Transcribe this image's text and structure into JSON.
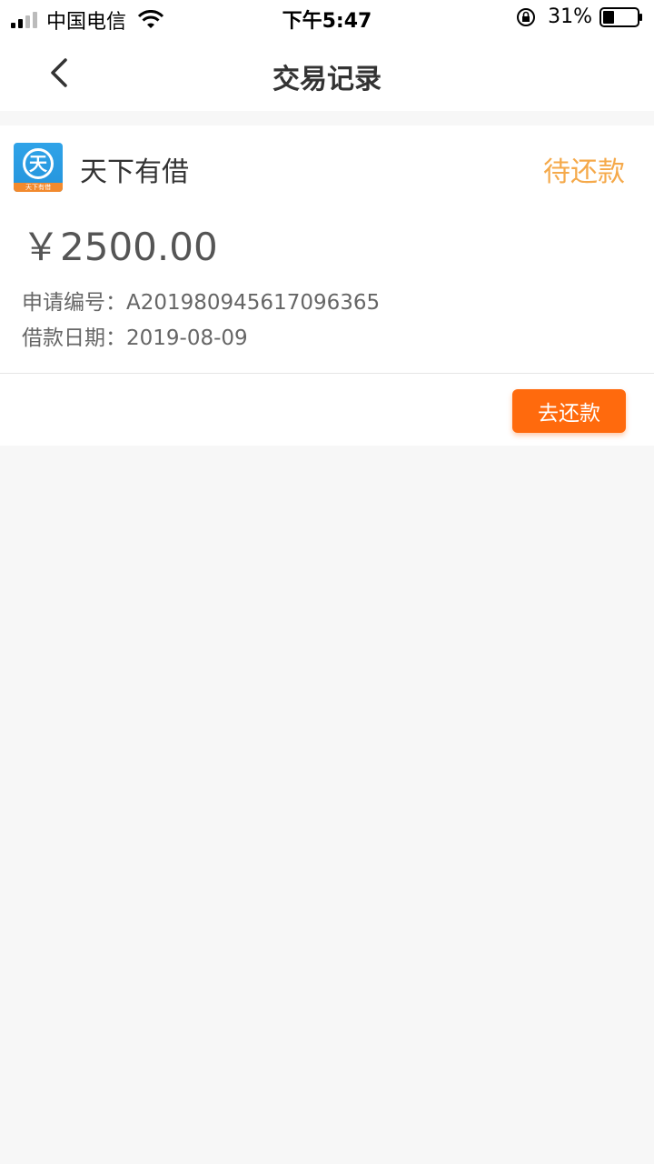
{
  "status_bar": {
    "carrier": "中国电信",
    "time": "下午5:47",
    "battery": "31%"
  },
  "nav": {
    "title": "交易记录"
  },
  "record": {
    "lender": "天下有借",
    "logo_text": "天",
    "logo_caption": "天下有借",
    "status": "待还款",
    "amount": "￥2500.00",
    "application_label": "申请编号：",
    "application_no": "A201980945617096365",
    "date_label": "借款日期：",
    "date": "2019-08-09",
    "repay_label": "去还款"
  },
  "colors": {
    "accent": "#ff6a0d",
    "status": "#f5a94a",
    "logo": "#2fa3e8"
  }
}
